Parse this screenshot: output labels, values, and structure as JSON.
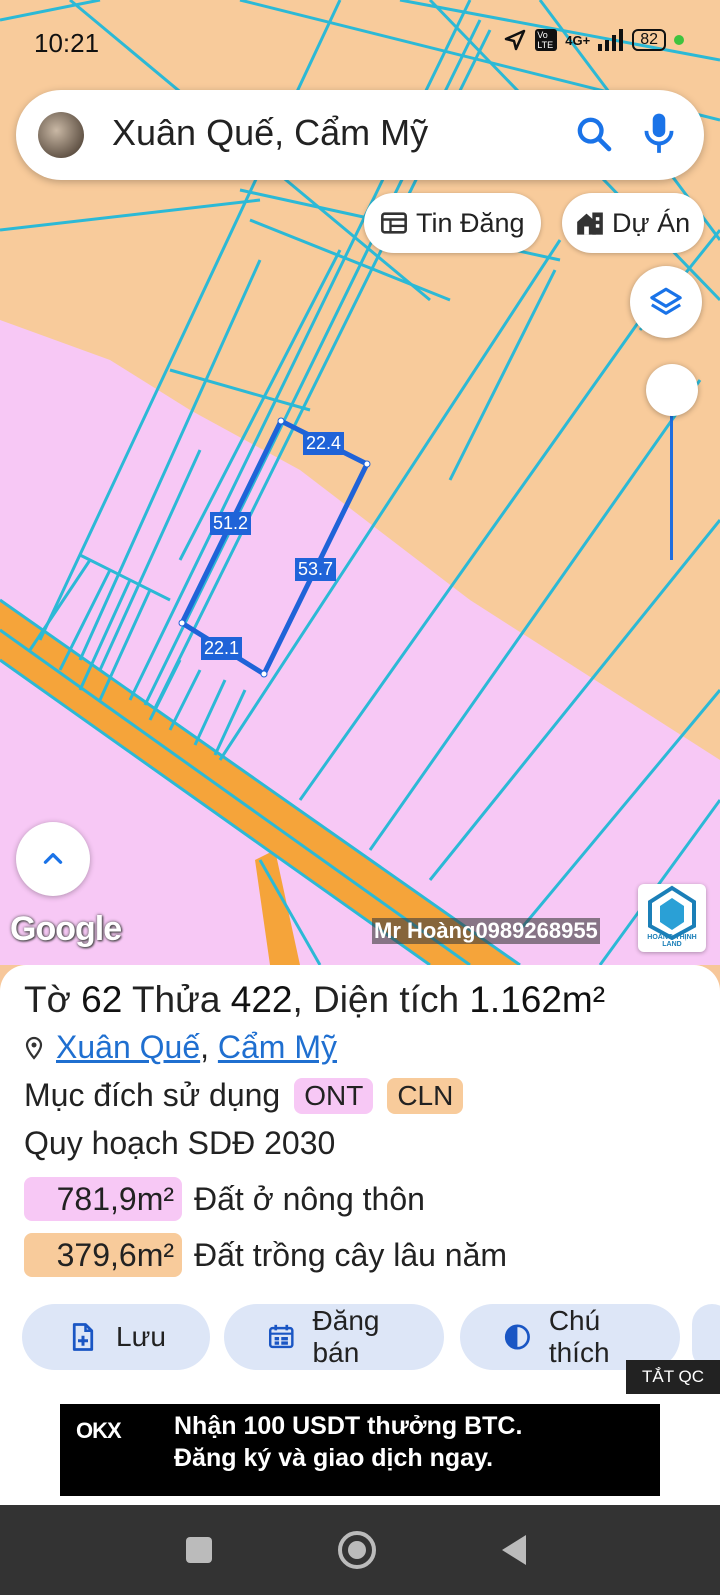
{
  "status_bar": {
    "time": "10:21",
    "network": "4G+",
    "volte": "Vo LTE",
    "battery": "82"
  },
  "search": {
    "query": "Xuân Quế, Cẩm Mỹ"
  },
  "chips": {
    "listings": "Tin Đăng",
    "projects": "Dự Án"
  },
  "map": {
    "plot_edges": [
      "22.4",
      "51.2",
      "53.7",
      "22.1"
    ],
    "google_label": "Google",
    "watermark": "Mr Hoàng0989268955",
    "brand": "HOÀNG THỊNH LAND",
    "colors": {
      "residential": "#f7c8f5",
      "perennial": "#f8cb9b",
      "road": "#f5a43a",
      "parcel_line": "#2cb9d6",
      "selected": "#1f63d8"
    }
  },
  "parcel": {
    "sheet_label": "Tờ",
    "sheet_no": "62",
    "plot_label": "Thửa",
    "plot_no": "422",
    "area_label": ", Diện tích",
    "area": "1.162m²",
    "commune": "Xuân Quế",
    "separator": ",",
    "district": "Cẩm Mỹ",
    "purpose_label": "Mục đích sử dụng",
    "purpose_tags": [
      "ONT",
      "CLN"
    ],
    "plan_label": "Quy hoạch SDĐ 2030",
    "zones": [
      {
        "area": "781,9m²",
        "label": "Đất ở nông thôn",
        "color": "#f7c8f5"
      },
      {
        "area": "379,6m²",
        "label": "Đất trồng cây lâu năm",
        "color": "#f8cb9b"
      }
    ]
  },
  "actions": {
    "save": "Lưu",
    "post_sale": "Đăng bán",
    "legend": "Chú thích"
  },
  "ad": {
    "close_label": "TẮT QC",
    "brand": "OKX",
    "line1": "Nhận 100 USDT thưởng BTC.",
    "line2": "Đăng ký và giao dịch ngay."
  }
}
